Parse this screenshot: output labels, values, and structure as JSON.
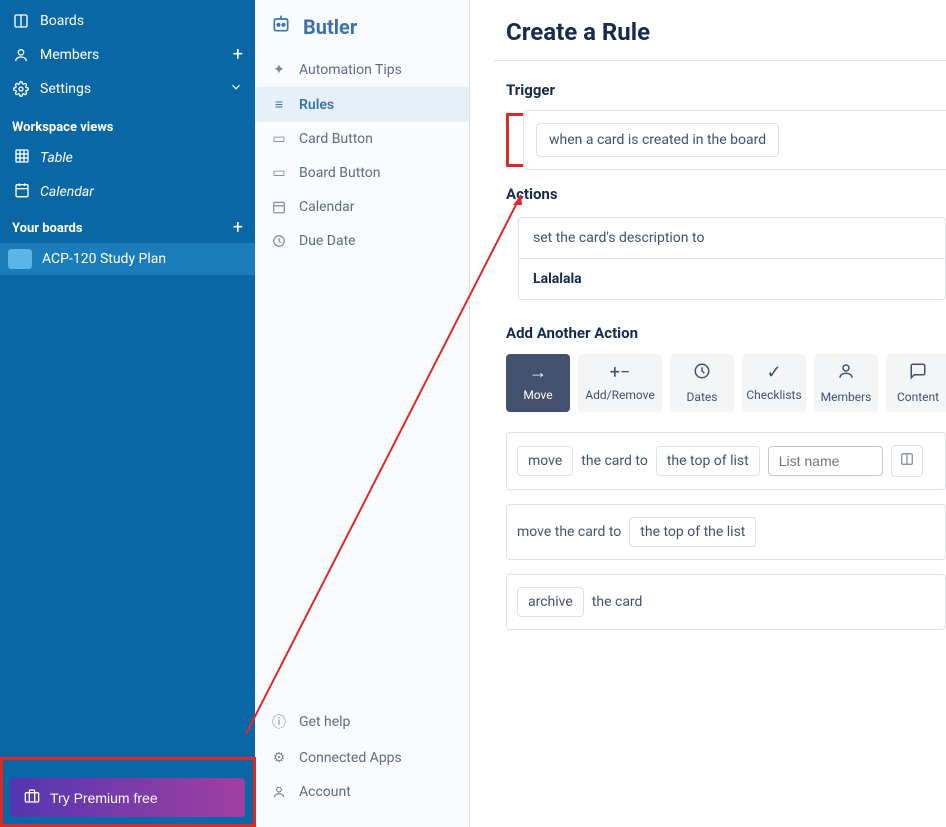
{
  "sidebar_left": {
    "boards": "Boards",
    "members": "Members",
    "settings": "Settings",
    "workspace_views": "Workspace views",
    "table": "Table",
    "calendar": "Calendar",
    "your_boards": "Your boards",
    "board_name": "ACP-120 Study Plan",
    "premium": "Try Premium free"
  },
  "sidebar_mid": {
    "title": "Butler",
    "automation_tips": "Automation Tips",
    "rules": "Rules",
    "card_button": "Card Button",
    "board_button": "Board Button",
    "calendar": "Calendar",
    "due_date": "Due Date",
    "get_help": "Get help",
    "connected_apps": "Connected Apps",
    "account": "Account"
  },
  "main": {
    "title": "Create a Rule",
    "trigger_label": "Trigger",
    "trigger_text": "when a card is created in the board",
    "actions_label": "Actions",
    "action_desc": "set the card's description to",
    "action_val": "Lalalala",
    "add_another": "Add Another Action",
    "tabs": {
      "move": "Move",
      "add_remove": "Add/Remove",
      "dates": "Dates",
      "checklists": "Checklists",
      "members": "Members",
      "content": "Content"
    },
    "row1": {
      "move": "move",
      "the_card_to": "the card to",
      "top_of_list": "the top of list",
      "list_name_placeholder": "List name"
    },
    "row2": {
      "move_card_to": "move the card to",
      "top_of_list": "the top of the list"
    },
    "row3": {
      "archive": "archive",
      "the_card": "the card"
    }
  }
}
